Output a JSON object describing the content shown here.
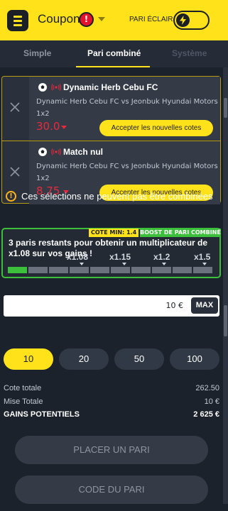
{
  "header": {
    "title": "Coupon",
    "alert_badge": "!",
    "eclair_label": "PARI ÉCLAIR",
    "eclair_enabled": false
  },
  "tabs": [
    {
      "label": "Simple",
      "state": "inactive"
    },
    {
      "label": "Pari combiné",
      "state": "active"
    },
    {
      "label": "Système",
      "state": "disabled"
    }
  ],
  "selections": [
    {
      "name": "Dynamic Herb Cebu FC",
      "event": "Dynamic Herb Cebu FC vs Jeonbuk Hyundai Motors",
      "market": "1x2",
      "odds": "30.0",
      "odds_trend": "down",
      "accept_label": "Accepter les nouvelles cotes"
    },
    {
      "name": "Match nul",
      "event": "Dynamic Herb Cebu FC vs Jeonbuk Hyundai Motors",
      "market": "1x2",
      "odds": "8.75",
      "odds_trend": "down",
      "accept_label": "Accepter les nouvelles cotes"
    }
  ],
  "warning": {
    "icon": "!",
    "text": "Ces sélections ne peuvent pas être combinées"
  },
  "boost": {
    "cote_min": "COTE MIN: 1.4",
    "tag": "BOOST DE PARI COMBINÉ",
    "message": "3 paris restants pour obtenir un multiplicateur de x1.08 sur vos gains !",
    "multipliers": [
      "x1.08",
      "x1.15",
      "x1.2",
      "x1.5"
    ],
    "progress_total": 10,
    "progress_done": 1
  },
  "stake": {
    "value": "10 €",
    "max_label": "MAX"
  },
  "presets": [
    {
      "label": "10",
      "active": true
    },
    {
      "label": "20",
      "active": false
    },
    {
      "label": "50",
      "active": false
    },
    {
      "label": "100",
      "active": false
    }
  ],
  "summary": {
    "cote_totale_label": "Cote totale",
    "cote_totale_value": "262.50",
    "mise_totale_label": "Mise Totale",
    "mise_totale_value": "10 €",
    "gains_label": "GAINS POTENTIELS",
    "gains_value": "2 625 €"
  },
  "actions": {
    "place_bet": "PLACER UN PARI",
    "bet_code": "CODE DU PARI"
  },
  "colors": {
    "brand_yellow": "#ffe21a",
    "background": "#1c222c",
    "odds_down_red": "#e8293d",
    "boost_green": "#3cc03c",
    "warning_orange": "#ffb31a"
  }
}
